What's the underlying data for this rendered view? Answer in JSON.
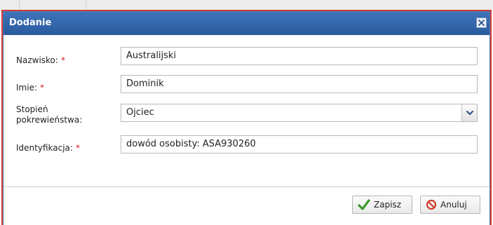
{
  "dialog": {
    "title": "Dodanie",
    "close_icon": "close-icon"
  },
  "form": {
    "surname": {
      "label": "Nazwisko:",
      "required_mark": "*",
      "value": "Australijski"
    },
    "first_name": {
      "label": "Imie:",
      "required_mark": "*",
      "value": "Dominik"
    },
    "relationship": {
      "label_line1": "Stopień",
      "label_line2": "pokrewieństwa:",
      "selected": "Ojciec",
      "icon": "chevron-down-icon"
    },
    "identification": {
      "label": "Identyfikacja:",
      "required_mark": "*",
      "value": "dowód osobisty: ASA930260"
    }
  },
  "buttons": {
    "save": {
      "label": "Zapisz",
      "icon": "checkmark-icon"
    },
    "cancel": {
      "label": "Anuluj",
      "icon": "cancel-icon"
    }
  },
  "colors": {
    "titlebar": "#2f62a8",
    "required": "#d21f1f",
    "save_icon": "#3a9a2a",
    "cancel_icon": "#d23a2a"
  }
}
